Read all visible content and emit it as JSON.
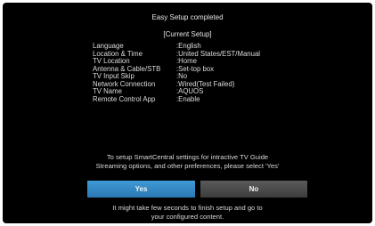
{
  "header": {
    "title": "Easy Setup completed",
    "subtitle": "[Current Setup]"
  },
  "settings": [
    {
      "label": "Language",
      "value": ":English"
    },
    {
      "label": "Location & Time",
      "value": ":United States/EST/Manual"
    },
    {
      "label": "TV Location",
      "value": ":Home"
    },
    {
      "label": "Antenna & Cable/STB",
      "value": ":Set-top box"
    },
    {
      "label": "TV Input Skip",
      "value": ":No"
    },
    {
      "label": "Network Connection",
      "value": ":Wired(Test Failed)"
    },
    {
      "label": "TV Name",
      "value": ":AQUOS"
    },
    {
      "label": "Remote Control App",
      "value": ":Enable"
    }
  ],
  "prompt": {
    "line1": "To setup SmartCentral settings for intractive TV Guide",
    "line2": "Streaming options, and other preferences, please select 'Yes'"
  },
  "buttons": {
    "yes_label": "Yes",
    "no_label": "No"
  },
  "footer": {
    "line1": "It might take few seconds to finish setup and go to",
    "line2": "your configured content."
  },
  "colors": {
    "background": "#000000",
    "yes_button": "#2f86c6",
    "no_button": "#4a4a4a",
    "text": "#e6e6e6"
  }
}
